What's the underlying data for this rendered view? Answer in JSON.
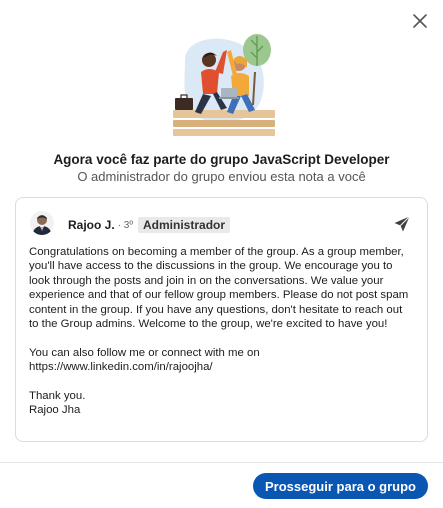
{
  "modal": {
    "close_icon": "close-icon",
    "heading": "Agora você faz parte do grupo JavaScript Developer",
    "subheading": "O administrador do grupo enviou esta nota a você"
  },
  "note": {
    "author_name": "Rajoo J.",
    "degree": "· 3º",
    "role_badge": "Administrador",
    "send_icon": "send-icon",
    "paragraphs": [
      "Congratulations on becoming a member of the group. As a group member, you'll have access to the discussions in the group. We encourage you to look through the posts and join in on the conversations. We value your experience and that of our fellow group members. Please do not post spam content in the group. If you have any questions, don't hesitate to reach out to the Group admins. Welcome to the group, we're excited to have you!",
      "You can also follow me or connect with me on https://www.linkedin.com/in/rajoojha/",
      "Thank you.",
      "Rajoo Jha"
    ]
  },
  "footer": {
    "primary_button": "Prosseguir para o grupo"
  },
  "colors": {
    "primary": "#0a56b3",
    "badge_bg": "#e9e9e9",
    "border": "#dcdcdc"
  }
}
